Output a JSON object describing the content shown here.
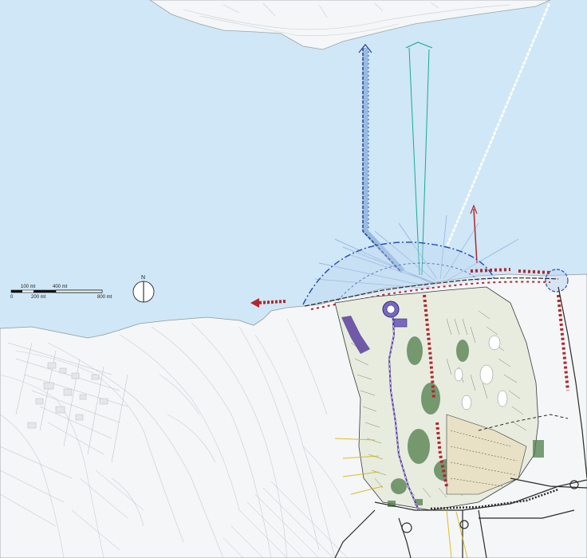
{
  "map": {
    "colors": {
      "sea": "#cfe7f6",
      "land": "#f4f6f7",
      "contour": "#c9ced3",
      "road": "#2a2a2a",
      "promenade": "#d8e9c8",
      "vegetation": "#4f7d4a",
      "hatch": "#556b55",
      "blue_axis": "#4a55b0",
      "teal_axis": "#1aa89a",
      "red_marker": "#b3262e",
      "purple_path": "#5a3f9e",
      "yellow_rays": "#d8b400",
      "dotted_axis": "#ffffff",
      "dome": "#2d4fb0"
    },
    "scale_bar": {
      "label_100": "100 mt",
      "label_400": "400 mt",
      "label_0": "0",
      "label_200": "200 mt",
      "label_800": "800 mt"
    },
    "north_arrow": {
      "label": "N"
    }
  }
}
